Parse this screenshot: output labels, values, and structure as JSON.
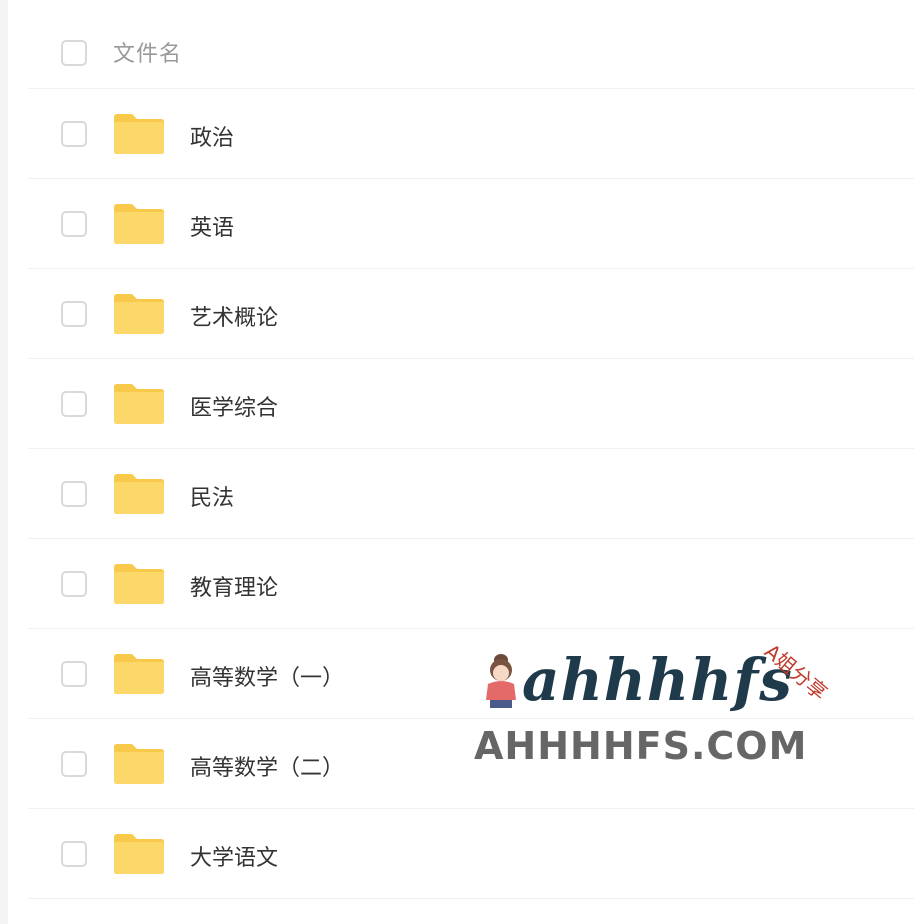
{
  "header": {
    "column_label": "文件名"
  },
  "files": [
    {
      "name": "政治",
      "icon": "folder-icon"
    },
    {
      "name": "英语",
      "icon": "folder-icon"
    },
    {
      "name": "艺术概论",
      "icon": "folder-icon"
    },
    {
      "name": "医学综合",
      "icon": "folder-icon"
    },
    {
      "name": "民法",
      "icon": "folder-icon"
    },
    {
      "name": "教育理论",
      "icon": "folder-icon"
    },
    {
      "name": "高等数学（一）",
      "icon": "folder-icon"
    },
    {
      "name": "高等数学（二）",
      "icon": "folder-icon"
    },
    {
      "name": "大学语文",
      "icon": "folder-icon"
    }
  ],
  "watermark": {
    "script_text": "ahhhhfs",
    "tag": "A姐分享",
    "domain": "AHHHHFS.COM"
  },
  "colors": {
    "folder": "#fcd76a",
    "folder_tab": "#f8c94a",
    "divider": "#eef0f3",
    "checkbox_border": "#d9d9d9"
  }
}
